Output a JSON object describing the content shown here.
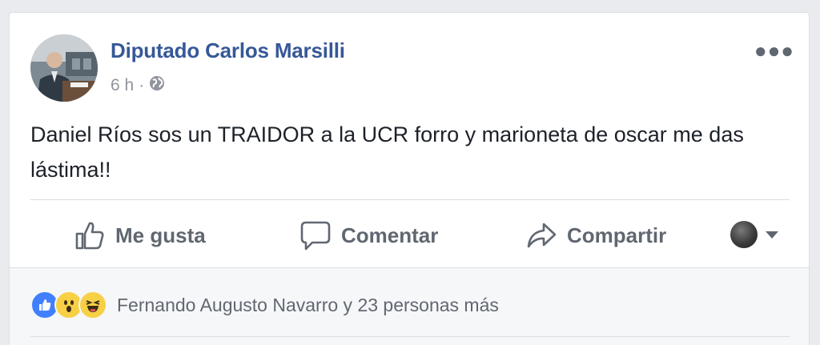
{
  "post": {
    "author": "Diputado Carlos Marsilli",
    "timestamp": "6 h",
    "separator": "·",
    "privacy_icon": "globe-icon",
    "more_icon": "more-dots-icon",
    "text": "Daniel Ríos sos un TRAIDOR a la UCR forro y marioneta de oscar me das lástima!!"
  },
  "actions": {
    "like": {
      "label": "Me gusta",
      "icon": "thumbs-up-icon"
    },
    "comment": {
      "label": "Comentar",
      "icon": "comment-bubble-icon"
    },
    "share": {
      "label": "Compartir",
      "icon": "share-arrow-icon"
    },
    "audience_selector_icon": "chevron-down-icon"
  },
  "reactions": {
    "icons": [
      "like-reaction-icon",
      "wow-reaction-icon",
      "haha-reaction-icon"
    ],
    "summary": "Fernando Augusto Navarro y 23 personas más"
  },
  "colors": {
    "author_link": "#365899",
    "secondary_text": "#90949c",
    "action_text": "#606770",
    "like_blue": "#4080ff",
    "emoji_yellow": "#f7d046"
  }
}
